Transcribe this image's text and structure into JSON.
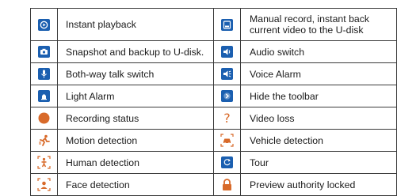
{
  "rows": [
    {
      "left": {
        "icon": "instant-playback-icon",
        "label": "Instant playback"
      },
      "right": {
        "icon": "manual-record-icon",
        "label": "Manual record, instant back current video to the U-disk"
      }
    },
    {
      "left": {
        "icon": "snapshot-icon",
        "label": "Snapshot and backup to U-disk."
      },
      "right": {
        "icon": "audio-switch-icon",
        "label": "Audio switch"
      }
    },
    {
      "left": {
        "icon": "microphone-icon",
        "label": "Both-way talk switch"
      },
      "right": {
        "icon": "voice-alarm-icon",
        "label": "Voice Alarm"
      }
    },
    {
      "left": {
        "icon": "light-alarm-icon",
        "label": "Light Alarm"
      },
      "right": {
        "icon": "hide-toolbar-icon",
        "label": "Hide the toolbar"
      }
    },
    {
      "left": {
        "icon": "recording-status-icon",
        "label": "Recording status"
      },
      "right": {
        "icon": "question-mark-icon",
        "label": "Video loss"
      }
    },
    {
      "left": {
        "icon": "running-person-icon",
        "label": "Motion detection"
      },
      "right": {
        "icon": "car-icon",
        "label": "Vehicle detection"
      }
    },
    {
      "left": {
        "icon": "human-detection-icon",
        "label": "Human detection"
      },
      "right": {
        "icon": "tour-icon",
        "label": "Tour"
      }
    },
    {
      "left": {
        "icon": "face-detection-icon",
        "label": "Face detection"
      },
      "right": {
        "icon": "lock-icon",
        "label": "Preview authority locked"
      }
    }
  ],
  "video_loss_glyph": "?",
  "colors": {
    "icon_blue": "#1b5fb0",
    "icon_orange": "#d86a2a",
    "border": "#3a3a3a"
  }
}
